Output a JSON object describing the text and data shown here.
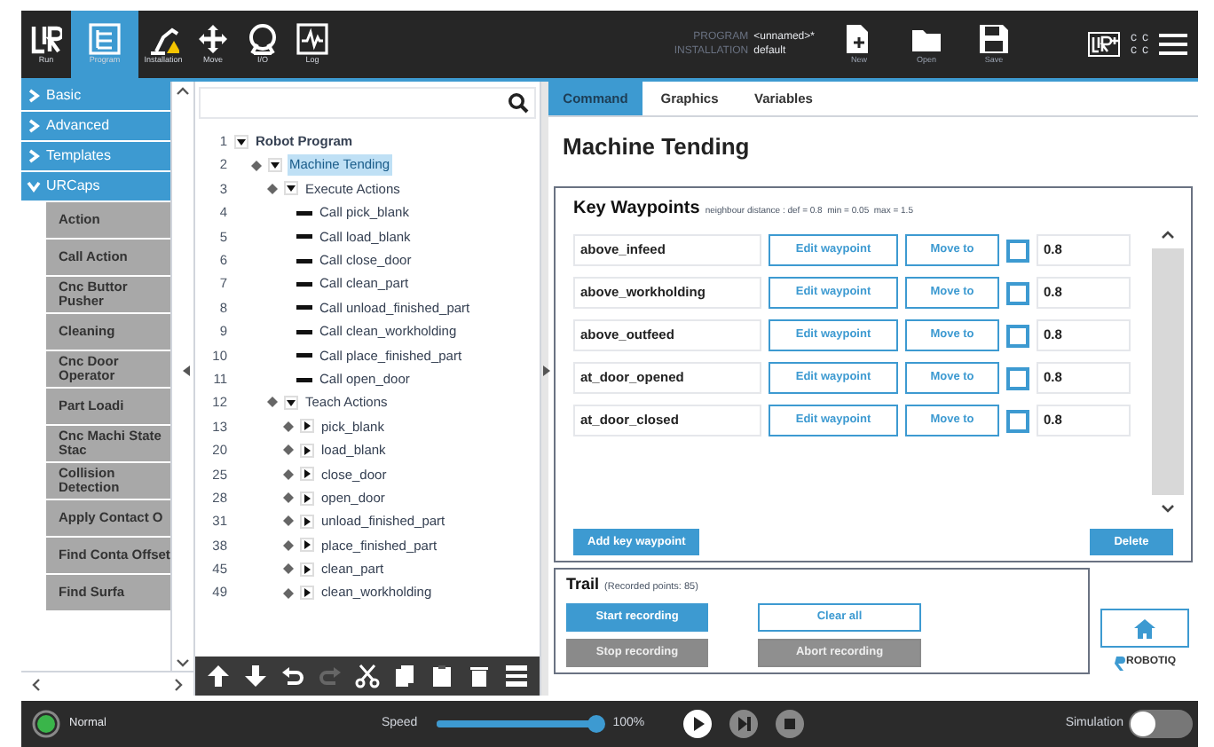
{
  "header": {
    "tabs": [
      {
        "label": "Run",
        "kind": "run",
        "selected": false
      },
      {
        "label": "Program",
        "kind": "program",
        "selected": true
      },
      {
        "label": "Installation",
        "kind": "installation",
        "selected": false
      },
      {
        "label": "Move",
        "kind": "move",
        "selected": false
      },
      {
        "label": "I/O",
        "kind": "io",
        "selected": false
      },
      {
        "label": "Log",
        "kind": "log",
        "selected": false
      }
    ],
    "program": {
      "label": "PROGRAM",
      "value": "<unnamed>*"
    },
    "installation": {
      "label": "INSTALLATION",
      "value": "default"
    },
    "file_buttons": [
      {
        "label": "New",
        "kind": "new"
      },
      {
        "label": "Open",
        "kind": "open"
      },
      {
        "label": "Save",
        "kind": "save"
      }
    ],
    "indicators": [
      "c",
      "c",
      "c",
      "c"
    ]
  },
  "sidebar": {
    "categories": [
      {
        "label": "Basic",
        "expanded": false
      },
      {
        "label": "Advanced",
        "expanded": false
      },
      {
        "label": "Templates",
        "expanded": false
      },
      {
        "label": "URCaps",
        "expanded": true
      }
    ],
    "items": [
      "Action",
      "Call Action",
      "Cnc Buttor Pusher",
      "Cleaning",
      "Cnc Door Operator",
      "Part Loadi",
      "Cnc Machi State Stac",
      "Collision Detection",
      "Apply Contact O",
      "Find Conta Offset",
      "Find Surfa"
    ]
  },
  "tree": {
    "nodes": [
      {
        "number": "1",
        "label": "Robot Program",
        "kind": "program",
        "expanded": true,
        "selected": false,
        "children": [
          {
            "number": "2",
            "label": "Machine Tending",
            "kind": "folder",
            "expanded": true,
            "selected": true,
            "children": [
              {
                "number": "3",
                "label": "Execute Actions",
                "kind": "folder",
                "expanded": true,
                "selected": false,
                "children": [
                  {
                    "number": "4",
                    "label": "Call pick_blank",
                    "kind": "call",
                    "selected": false
                  },
                  {
                    "number": "5",
                    "label": "Call load_blank",
                    "kind": "call",
                    "selected": false
                  },
                  {
                    "number": "6",
                    "label": "Call close_door",
                    "kind": "call",
                    "selected": false
                  },
                  {
                    "number": "7",
                    "label": "Call clean_part",
                    "kind": "call",
                    "selected": false
                  },
                  {
                    "number": "8",
                    "label": "Call unload_finished_part",
                    "kind": "call",
                    "selected": false
                  },
                  {
                    "number": "9",
                    "label": "Call clean_workholding",
                    "kind": "call",
                    "selected": false
                  },
                  {
                    "number": "10",
                    "label": "Call place_finished_part",
                    "kind": "call",
                    "selected": false
                  },
                  {
                    "number": "11",
                    "label": "Call open_door",
                    "kind": "call",
                    "selected": false
                  }
                ]
              },
              {
                "number": "12",
                "label": "Teach Actions",
                "kind": "folder",
                "expanded": true,
                "selected": false,
                "children": [
                  {
                    "number": "13",
                    "label": "pick_blank",
                    "kind": "subprogram",
                    "expanded": false,
                    "selected": false
                  },
                  {
                    "number": "20",
                    "label": "load_blank",
                    "kind": "subprogram",
                    "expanded": false,
                    "selected": false
                  },
                  {
                    "number": "25",
                    "label": "close_door",
                    "kind": "subprogram",
                    "expanded": false,
                    "selected": false
                  },
                  {
                    "number": "28",
                    "label": "open_door",
                    "kind": "subprogram",
                    "expanded": false,
                    "selected": false
                  },
                  {
                    "number": "31",
                    "label": "unload_finished_part",
                    "kind": "subprogram",
                    "expanded": false,
                    "selected": false
                  },
                  {
                    "number": "38",
                    "label": "place_finished_part",
                    "kind": "subprogram",
                    "expanded": false,
                    "selected": false
                  },
                  {
                    "number": "45",
                    "label": "clean_part",
                    "kind": "subprogram",
                    "expanded": false,
                    "selected": false
                  },
                  {
                    "number": "49",
                    "label": "clean_workholding",
                    "kind": "subprogram",
                    "expanded": false,
                    "selected": false
                  }
                ]
              }
            ]
          }
        ]
      }
    ],
    "toolbar": [
      {
        "kind": "up",
        "disabled": false
      },
      {
        "kind": "down",
        "disabled": false
      },
      {
        "kind": "undo",
        "disabled": false
      },
      {
        "kind": "redo",
        "disabled": true
      },
      {
        "kind": "cut",
        "disabled": false
      },
      {
        "kind": "copy",
        "disabled": false
      },
      {
        "kind": "paste",
        "disabled": false
      },
      {
        "kind": "delete",
        "disabled": false
      },
      {
        "kind": "suppress",
        "disabled": false
      }
    ]
  },
  "panel": {
    "tabs": [
      {
        "label": "Command",
        "selected": true
      },
      {
        "label": "Graphics",
        "selected": false
      },
      {
        "label": "Variables",
        "selected": false
      }
    ],
    "title": "Machine Tending",
    "key_waypoints": {
      "title": "Key Waypoints",
      "note": "neighbour distance : def = 0.8  min = 0.05  max = 1.5",
      "rows": [
        {
          "name": "above_infeed",
          "edit": "Edit waypoint",
          "move": "Move to",
          "checked": false,
          "distance": "0.8"
        },
        {
          "name": "above_workholding",
          "edit": "Edit waypoint",
          "move": "Move to",
          "checked": false,
          "distance": "0.8"
        },
        {
          "name": "above_outfeed",
          "edit": "Edit waypoint",
          "move": "Move to",
          "checked": false,
          "distance": "0.8"
        },
        {
          "name": "at_door_opened",
          "edit": "Edit waypoint",
          "move": "Move to",
          "checked": false,
          "distance": "0.8"
        },
        {
          "name": "at_door_closed",
          "edit": "Edit waypoint",
          "move": "Move to",
          "checked": false,
          "distance": "0.8"
        }
      ],
      "add_button": "Add key waypoint",
      "delete_button": "Delete"
    },
    "trail": {
      "title": "Trail",
      "note": "(Recorded points: 85)",
      "buttons": [
        {
          "label": "Start recording",
          "kind": "primary",
          "disabled": false
        },
        {
          "label": "Clear all",
          "kind": "outline",
          "disabled": false
        },
        {
          "label": "Stop recording",
          "kind": "primary",
          "disabled": true
        },
        {
          "label": "Abort recording",
          "kind": "outline",
          "disabled": true
        }
      ]
    },
    "brand": "ROBOTIQ"
  },
  "footer": {
    "status": "Normal",
    "speed_label": "Speed",
    "speed": {
      "level": 1.0
    },
    "speed_reading": "100%",
    "simulation_label": "Simulation",
    "simulation_on": false
  }
}
